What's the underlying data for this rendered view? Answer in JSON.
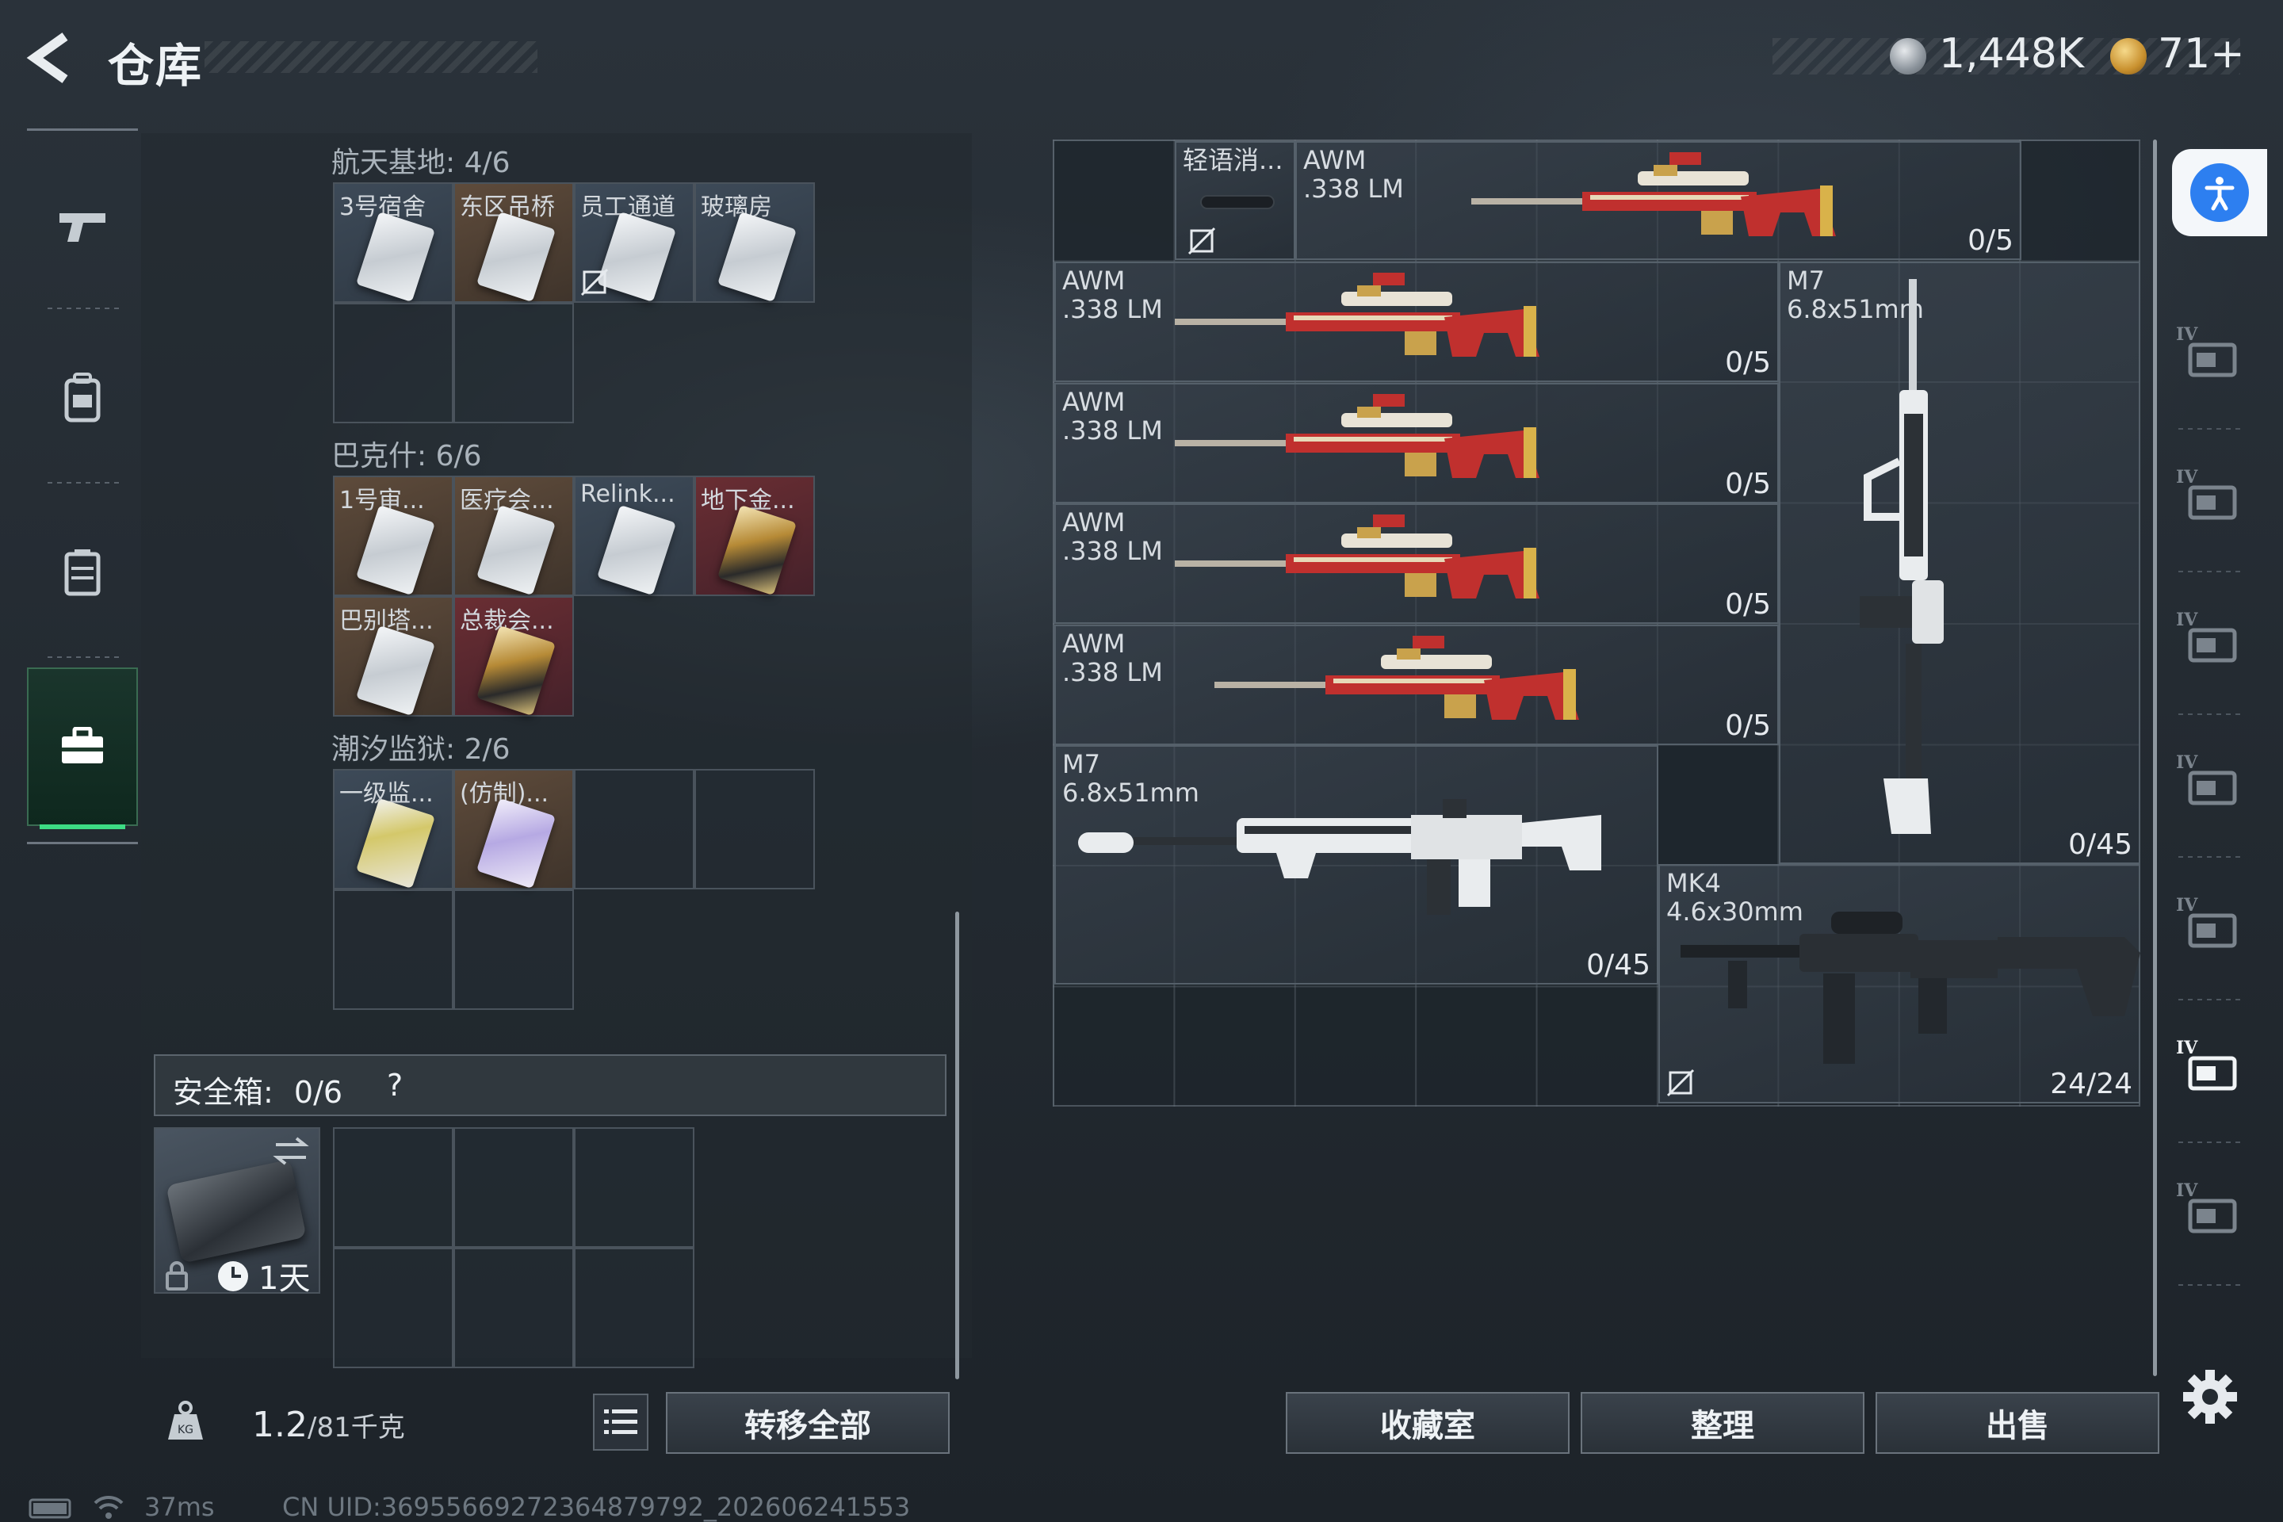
{
  "header": {
    "title": "仓库",
    "currencies": [
      {
        "icon": "silver-coin-icon",
        "value": "1,448K"
      },
      {
        "icon": "gold-coin-icon",
        "value": "71+"
      }
    ]
  },
  "left_nav": {
    "items": [
      {
        "icon": "pistol-icon",
        "active": false
      },
      {
        "icon": "backpack-icon",
        "active": false
      },
      {
        "icon": "vest-icon",
        "active": false
      },
      {
        "icon": "briefcase-icon",
        "active": true
      }
    ]
  },
  "key_groups": [
    {
      "title": "航天基地: 4/6",
      "cards": [
        {
          "label": "3号宿舍",
          "color": "blue",
          "locked": false
        },
        {
          "label": "东区吊桥",
          "color": "brown",
          "locked": false
        },
        {
          "label": "员工通道",
          "color": "blue",
          "locked": true
        },
        {
          "label": "玻璃房",
          "color": "blue",
          "locked": false
        }
      ]
    },
    {
      "title": "巴克什: 6/6",
      "cards": [
        {
          "label": "1号审...",
          "color": "brown"
        },
        {
          "label": "医疗会...",
          "color": "brown"
        },
        {
          "label": "Relink...",
          "color": "blue"
        },
        {
          "label": "地下金...",
          "color": "red"
        },
        {
          "label": "巴别塔...",
          "color": "brown"
        },
        {
          "label": "总裁会...",
          "color": "red"
        }
      ]
    },
    {
      "title": "潮汐监狱: 2/6",
      "cards": [
        {
          "label": "一级监...",
          "color": "blue"
        },
        {
          "label": "(仿制)...",
          "color": "brown"
        }
      ]
    }
  ],
  "safebox": {
    "label": "安全箱:",
    "count": "0/6",
    "help": "?",
    "timer": "1天"
  },
  "bottom_left": {
    "weight_current": "1.2",
    "weight_max": "/81千克",
    "transfer_label": "转移全部"
  },
  "stash_items": [
    {
      "name": "轻语消...",
      "sub": "",
      "count": ""
    },
    {
      "name": "AWM",
      "sub": ".338 LM",
      "count": "0/5"
    },
    {
      "name": "AWM",
      "sub": ".338 LM",
      "count": "0/5"
    },
    {
      "name": "AWM",
      "sub": ".338 LM",
      "count": "0/5"
    },
    {
      "name": "AWM",
      "sub": ".338 LM",
      "count": "0/5"
    },
    {
      "name": "AWM",
      "sub": ".338 LM",
      "count": "0/5"
    },
    {
      "name": "M7",
      "sub": "6.8x51mm",
      "count": "0/45"
    },
    {
      "name": "M7",
      "sub": "6.8x51mm",
      "count": "0/45"
    },
    {
      "name": "MK4",
      "sub": "4.6x30mm",
      "count": "24/24"
    }
  ],
  "bottom_right": {
    "collection_label": "收藏室",
    "sort_label": "整理",
    "sell_label": "出售"
  },
  "right_nav": {
    "tiers": [
      "IV",
      "IV",
      "IV",
      "IV",
      "IV",
      "IV",
      "IV"
    ]
  },
  "status": {
    "ping": "37ms",
    "uid": "CN UID:36955669272364879792_202606241553"
  },
  "colors": {
    "accent_green": "#3ddc84",
    "access_blue": "#2d7ff0",
    "awm_red": "#c0302e"
  }
}
